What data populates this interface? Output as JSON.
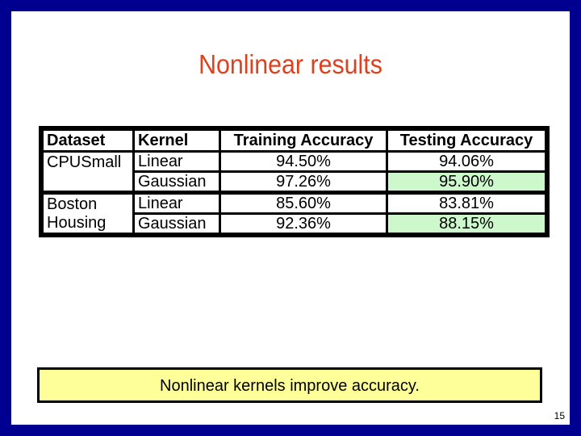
{
  "slide": {
    "title": "Nonlinear results",
    "table": {
      "headers": [
        "Dataset",
        "Kernel",
        "Training Accuracy",
        "Testing Accuracy"
      ],
      "groups": [
        {
          "dataset_lines": [
            "CPUSmall",
            ""
          ],
          "rows": [
            {
              "kernel": "Linear",
              "training": "94.50%",
              "testing": "94.06%",
              "highlight": false
            },
            {
              "kernel": "Gaussian",
              "training": "97.26%",
              "testing": "95.90%",
              "highlight": true
            }
          ]
        },
        {
          "dataset_lines": [
            "Boston",
            "Housing"
          ],
          "rows": [
            {
              "kernel": "Linear",
              "training": "85.60%",
              "testing": "83.81%",
              "highlight": false
            },
            {
              "kernel": "Gaussian",
              "training": "92.36%",
              "testing": "88.15%",
              "highlight": true
            }
          ]
        }
      ]
    },
    "callout": "Nonlinear kernels improve accuracy.",
    "slide_number": "15"
  },
  "colors": {
    "frame": "#000090",
    "title": "#e0401c",
    "highlight": "#ccf8cc",
    "callout_bg": "#ffff99"
  }
}
